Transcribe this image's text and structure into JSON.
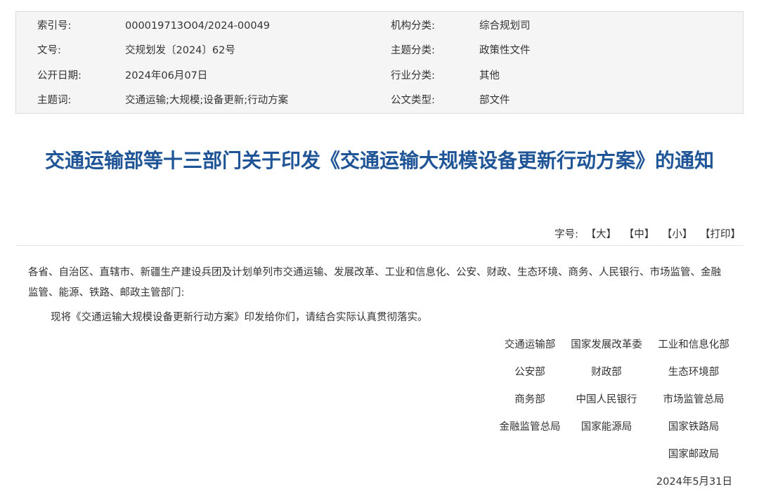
{
  "meta": {
    "rows": [
      [
        {
          "label": "索引号:",
          "value": "000019713O04/2024-00049"
        },
        {
          "label": "机构分类:",
          "value": "综合规划司"
        }
      ],
      [
        {
          "label": "文号:",
          "value": "交规划发〔2024〕62号"
        },
        {
          "label": "主题分类:",
          "value": "政策性文件"
        }
      ],
      [
        {
          "label": "公开日期:",
          "value": "2024年06月07日"
        },
        {
          "label": "行业分类:",
          "value": "其他"
        }
      ],
      [
        {
          "label": "主题词:",
          "value": "交通运输;大规模;设备更新;行动方案"
        },
        {
          "label": "公文类型:",
          "value": "部文件"
        }
      ]
    ]
  },
  "title": "交通运输部等十三部门关于印发《交通运输大规模设备更新行动方案》的通知",
  "font_bar": {
    "label": "字号:",
    "large": "【大】",
    "medium": "【中】",
    "small": "【小】",
    "print": "【打印】"
  },
  "body": {
    "recipients": "各省、自治区、直辖市、新疆生产建设兵团及计划单列市交通运输、发展改革、工业和信息化、公安、财政、生态环境、商务、人民银行、市场监管、金融监管、能源、铁路、邮政主管部门:",
    "notice": "现将《交通运输大规模设备更新行动方案》印发给你们，请结合实际认真贯彻落实。"
  },
  "signatories": [
    [
      "交通运输部",
      "国家发展改革委",
      "工业和信息化部"
    ],
    [
      "公安部",
      "财政部",
      "生态环境部"
    ],
    [
      "商务部",
      "中国人民银行",
      "市场监管总局"
    ],
    [
      "金融监管总局",
      "国家能源局",
      "国家铁路局"
    ],
    [
      "",
      "",
      "国家邮政局"
    ]
  ],
  "date": "2024年5月31日"
}
